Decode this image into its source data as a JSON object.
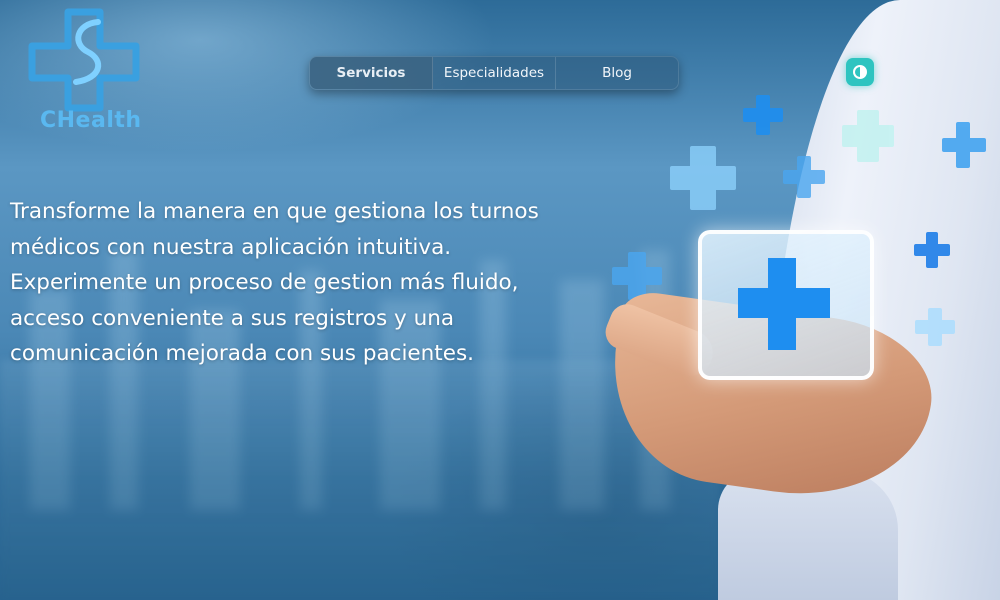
{
  "brand": {
    "name": "CHealth",
    "color": "#5ab8f0"
  },
  "nav": {
    "items": [
      {
        "label": "Servicios",
        "active": true
      },
      {
        "label": "Especialidades",
        "active": false
      },
      {
        "label": "Blog",
        "active": false
      }
    ]
  },
  "theme_toggle": {
    "icon": "contrast-icon",
    "color": "#2ec4c0"
  },
  "hero": {
    "text": "Transforme la manera en que gestiona los turnos médicos con nuestra aplicación intuitiva. Experimente un proceso de gestion más fluido, acceso conveniente a sus registros y una comunicación mejorada con sus pacientes."
  },
  "illustration": {
    "icons": [
      "medical-cross-icon"
    ],
    "accent": "#1e8ef0"
  }
}
